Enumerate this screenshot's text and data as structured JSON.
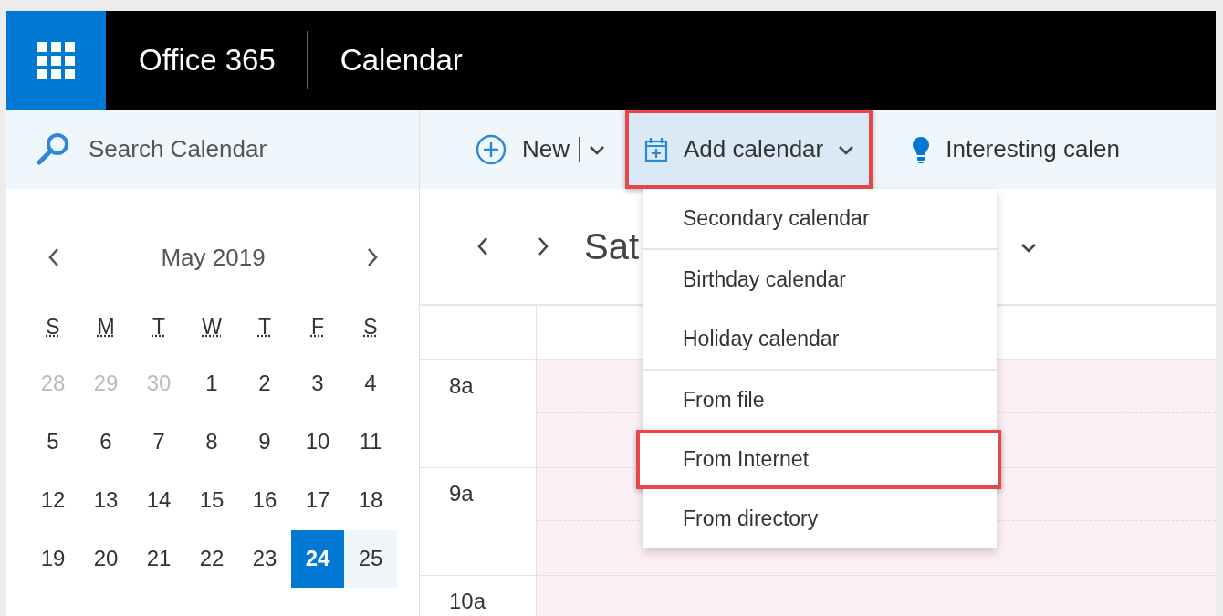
{
  "app_bar": {
    "brand": "Office 365",
    "app_name": "Calendar"
  },
  "search": {
    "placeholder": "Search Calendar"
  },
  "toolbar": [
    {
      "kind": "new",
      "label": "New",
      "split": true,
      "highlighted": false,
      "expanded": false
    },
    {
      "kind": "add",
      "label": "Add calendar",
      "split": false,
      "highlighted": true,
      "expanded": true
    },
    {
      "kind": "interesting",
      "label": "Interesting calen",
      "split": false,
      "highlighted": false,
      "expanded": false
    }
  ],
  "mini_calendar": {
    "month": "May 2019",
    "weekdays": [
      "S",
      "M",
      "T",
      "W",
      "T",
      "F",
      "S"
    ],
    "weeks": [
      [
        {
          "day": "28",
          "other_month": true,
          "today": false,
          "selected": false
        },
        {
          "day": "29",
          "other_month": true,
          "today": false,
          "selected": false
        },
        {
          "day": "30",
          "other_month": true,
          "today": false,
          "selected": false
        },
        {
          "day": "1",
          "other_month": false,
          "today": false,
          "selected": false
        },
        {
          "day": "2",
          "other_month": false,
          "today": false,
          "selected": false
        },
        {
          "day": "3",
          "other_month": false,
          "today": false,
          "selected": false
        },
        {
          "day": "4",
          "other_month": false,
          "today": false,
          "selected": false
        }
      ],
      [
        {
          "day": "5",
          "other_month": false,
          "today": false,
          "selected": false
        },
        {
          "day": "6",
          "other_month": false,
          "today": false,
          "selected": false
        },
        {
          "day": "7",
          "other_month": false,
          "today": false,
          "selected": false
        },
        {
          "day": "8",
          "other_month": false,
          "today": false,
          "selected": false
        },
        {
          "day": "9",
          "other_month": false,
          "today": false,
          "selected": false
        },
        {
          "day": "10",
          "other_month": false,
          "today": false,
          "selected": false
        },
        {
          "day": "11",
          "other_month": false,
          "today": false,
          "selected": false
        }
      ],
      [
        {
          "day": "12",
          "other_month": false,
          "today": false,
          "selected": false
        },
        {
          "day": "13",
          "other_month": false,
          "today": false,
          "selected": false
        },
        {
          "day": "14",
          "other_month": false,
          "today": false,
          "selected": false
        },
        {
          "day": "15",
          "other_month": false,
          "today": false,
          "selected": false
        },
        {
          "day": "16",
          "other_month": false,
          "today": false,
          "selected": false
        },
        {
          "day": "17",
          "other_month": false,
          "today": false,
          "selected": false
        },
        {
          "day": "18",
          "other_month": false,
          "today": false,
          "selected": false
        }
      ],
      [
        {
          "day": "19",
          "other_month": false,
          "today": false,
          "selected": false
        },
        {
          "day": "20",
          "other_month": false,
          "today": false,
          "selected": false
        },
        {
          "day": "21",
          "other_month": false,
          "today": false,
          "selected": false
        },
        {
          "day": "22",
          "other_month": false,
          "today": false,
          "selected": false
        },
        {
          "day": "23",
          "other_month": false,
          "today": false,
          "selected": false
        },
        {
          "day": "24",
          "other_month": false,
          "today": true,
          "selected": false
        },
        {
          "day": "25",
          "other_month": false,
          "today": false,
          "selected": true
        }
      ]
    ]
  },
  "day_view": {
    "title_start": "Sat",
    "hours": [
      "8a",
      "9a",
      "10a"
    ]
  },
  "add_calendar_menu": {
    "groups": [
      [
        {
          "label": "Secondary calendar",
          "highlighted": false
        }
      ],
      [
        {
          "label": "Birthday calendar",
          "highlighted": false
        },
        {
          "label": "Holiday calendar",
          "highlighted": false
        }
      ],
      [
        {
          "label": "From file",
          "highlighted": false
        },
        {
          "label": "From Internet",
          "highlighted": true
        },
        {
          "label": "From directory",
          "highlighted": false
        }
      ]
    ]
  }
}
